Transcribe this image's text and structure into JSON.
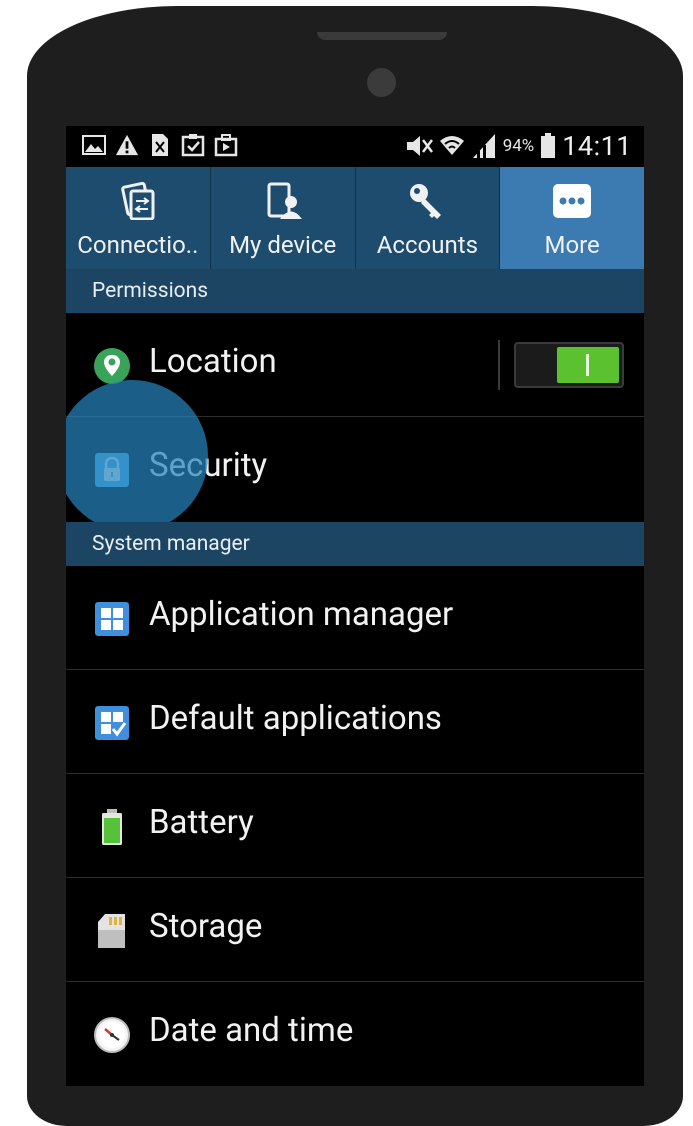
{
  "status_bar": {
    "icons": [
      "image-icon",
      "warning-icon",
      "screen-mirroring-icon",
      "clipboard-check-icon",
      "briefcase-play-icon"
    ],
    "right_icons": [
      "mute-icon",
      "wifi-icon",
      "signal-icon",
      "battery-icon"
    ],
    "battery_percent": "94%",
    "time": "14:11"
  },
  "tabs": [
    {
      "label": "Connectio..",
      "icon": "connections-icon",
      "selected": false
    },
    {
      "label": "My device",
      "icon": "my-device-icon",
      "selected": false
    },
    {
      "label": "Accounts",
      "icon": "key-icon",
      "selected": false
    },
    {
      "label": "More",
      "icon": "more-dots-icon",
      "selected": true
    }
  ],
  "sections": {
    "permissions": "Permissions",
    "system_manager": "System manager"
  },
  "rows": {
    "location": {
      "label": "Location",
      "icon": "location-pin-icon",
      "toggle_on": true
    },
    "security": {
      "label": "Security",
      "icon": "lock-icon"
    },
    "application_manager": {
      "label": "Application manager",
      "icon": "grid-apps-icon"
    },
    "default_applications": {
      "label": "Default applications",
      "icon": "default-apps-check-icon"
    },
    "battery": {
      "label": "Battery",
      "icon": "battery-icon"
    },
    "storage": {
      "label": "Storage",
      "icon": "sd-card-icon"
    },
    "date_time": {
      "label": "Date and time",
      "icon": "clock-icon"
    }
  },
  "colors": {
    "tab_bar": "#1e4c6e",
    "tab_selected": "#3c7bb2",
    "section_header": "#1b4563",
    "toggle_on": "#5cc12e",
    "touch_highlight": "#2684be"
  }
}
